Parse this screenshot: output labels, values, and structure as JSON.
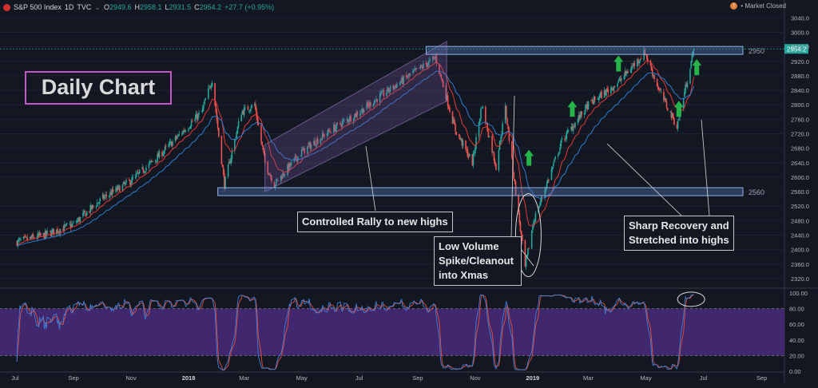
{
  "header": {
    "symbol": "S&P 500 Index",
    "interval": "1D",
    "source": "TVC",
    "chevron": "⌄",
    "o_label": "O",
    "o_value": "2949.6",
    "h_label": "H",
    "h_value": "2958.1",
    "l_label": "L",
    "l_value": "2931.5",
    "c_label": "C",
    "c_value": "2954.2",
    "change": "+27.7 (+0.95%)"
  },
  "status": {
    "text": "• Market Closed",
    "icon": "info-icon"
  },
  "annotations": {
    "daily_chart": "Daily Chart",
    "controlled_rally": "Controlled Rally to new highs",
    "low_volume_1": "Low Volume",
    "low_volume_2": "Spike/Cleanout",
    "low_volume_3": "into Xmas",
    "sharp_1": "Sharp Recovery and",
    "sharp_2": "Stretched into highs"
  },
  "colors": {
    "background": "#131722",
    "up": "#26a69a",
    "down": "#ef5350",
    "ema_fast": "#e53935",
    "ema_slow": "#2e7bcf",
    "zone": "#5b84c7",
    "channel": "#7b5aa6",
    "stoch_band": "#4a2a7a",
    "arrow": "#25b34a"
  },
  "chart_data": [
    {
      "type": "candlestick",
      "name": "S&P 500 Index",
      "interval": "1D",
      "x_tick_labels": [
        "Jul",
        "Sep",
        "Nov",
        "2018",
        "Mar",
        "May",
        "Jul",
        "Sep",
        "Nov",
        "2019",
        "Mar",
        "May",
        "Jul",
        "Sep"
      ],
      "y_tick_labels": [
        2320,
        2360,
        2400,
        2440,
        2480,
        2520,
        2560,
        2600,
        2640,
        2680,
        2720,
        2760,
        2800,
        2840,
        2880,
        2920,
        2960,
        3000,
        3040
      ],
      "ylim": [
        2300,
        3060
      ],
      "last_price": "2954.2",
      "levels": [
        {
          "label": "2950",
          "value": 2950
        },
        {
          "label": "2560",
          "value": 2560
        }
      ],
      "overlays": [
        "fast EMA",
        "slow EMA"
      ],
      "close_series": {
        "dates": [
          "2017-07-01",
          "2017-08-01",
          "2017-09-01",
          "2017-10-01",
          "2017-11-01",
          "2017-12-01",
          "2018-01-15",
          "2018-01-26",
          "2018-02-08",
          "2018-02-26",
          "2018-03-12",
          "2018-03-23",
          "2018-04-02",
          "2018-05-01",
          "2018-06-01",
          "2018-07-01",
          "2018-08-01",
          "2018-09-20",
          "2018-10-11",
          "2018-10-29",
          "2018-11-08",
          "2018-11-23",
          "2018-12-03",
          "2018-12-24",
          "2019-01-02",
          "2019-02-01",
          "2019-03-01",
          "2019-04-01",
          "2019-04-30",
          "2019-05-15",
          "2019-06-03",
          "2019-06-21"
        ],
        "close": [
          2420,
          2440,
          2470,
          2540,
          2590,
          2660,
          2780,
          2870,
          2580,
          2780,
          2800,
          2640,
          2580,
          2670,
          2730,
          2780,
          2840,
          2930,
          2730,
          2640,
          2800,
          2630,
          2790,
          2350,
          2480,
          2700,
          2800,
          2860,
          2945,
          2840,
          2740,
          2954
        ]
      },
      "xlim": [
        "2017-06-15",
        "2019-09-25"
      ]
    },
    {
      "type": "line",
      "name": "Stochastic",
      "y_tick_labels": [
        "0.00",
        "20.00",
        "40.00",
        "60.00",
        "80.00",
        "100.00"
      ],
      "ylim": [
        0,
        100
      ],
      "band": [
        20,
        80
      ]
    }
  ]
}
